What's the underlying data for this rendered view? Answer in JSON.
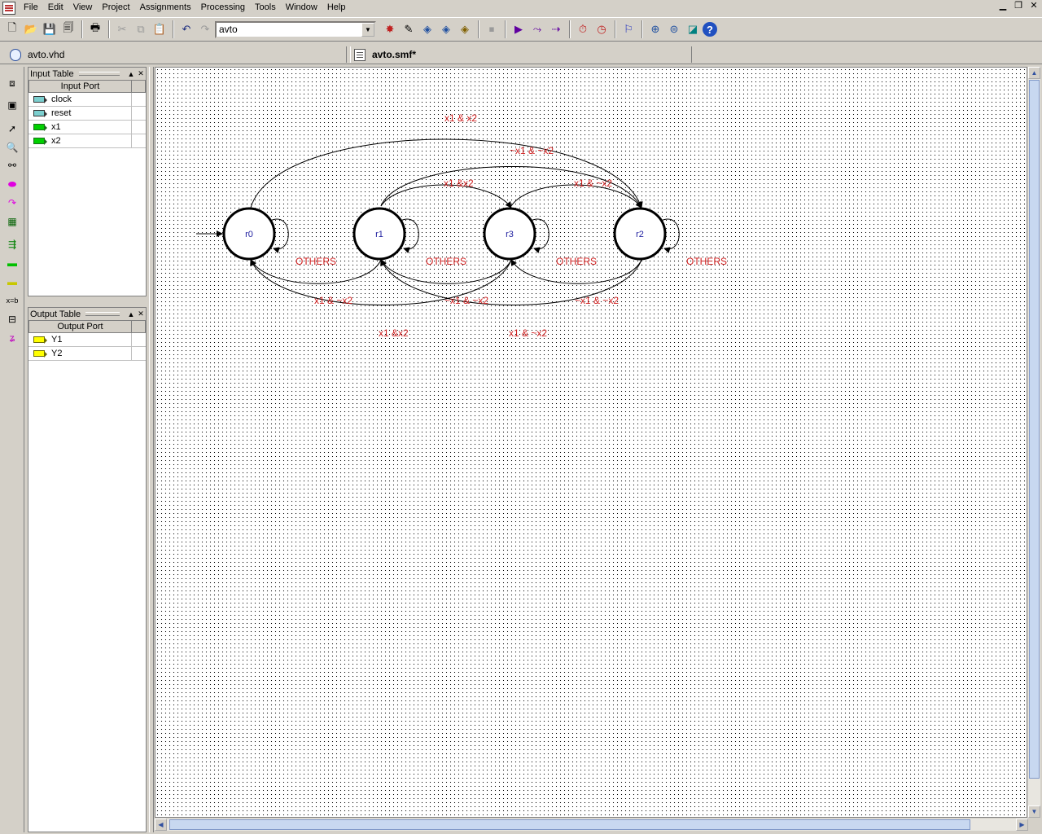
{
  "menu": {
    "items": [
      "File",
      "Edit",
      "View",
      "Project",
      "Assignments",
      "Processing",
      "Tools",
      "Window",
      "Help"
    ]
  },
  "window_controls": [
    "minimize-icon",
    "restore-icon",
    "close-icon"
  ],
  "toolbar": {
    "entity_value": "avto"
  },
  "tabs": {
    "vhd": "avto.vhd",
    "smf": "avto.smf*"
  },
  "input_table": {
    "title": "Input Table",
    "column": "Input Port",
    "ports": [
      "clock",
      "reset",
      "x1",
      "x2"
    ]
  },
  "output_table": {
    "title": "Output Table",
    "column": "Output Port",
    "ports": [
      "Y1",
      "Y2"
    ]
  },
  "diagram": {
    "states": [
      "r0",
      "r1",
      "r3",
      "r2"
    ],
    "transitions": {
      "r0_r2": "x1 & x2",
      "r1_r2": "~x1 & ~x2",
      "r1_r3": "x1 &x2",
      "r3_r2": "x1 & ~x2",
      "others_r0": "OTHERS",
      "others_r1": "OTHERS",
      "others_r3": "OTHERS",
      "others_r2": "OTHERS",
      "r1_r0": "x1 & ~x2",
      "r3_r1": "~x1 & ~x2",
      "r2_r3": "~x1 & ~x2",
      "r3_r0": "x1 &x2",
      "r2_r1": "x1 & ~x2"
    }
  },
  "colors": {
    "transition_label": "#d02020",
    "state_label": "#2020a0",
    "chrome": "#d4d0c8"
  }
}
